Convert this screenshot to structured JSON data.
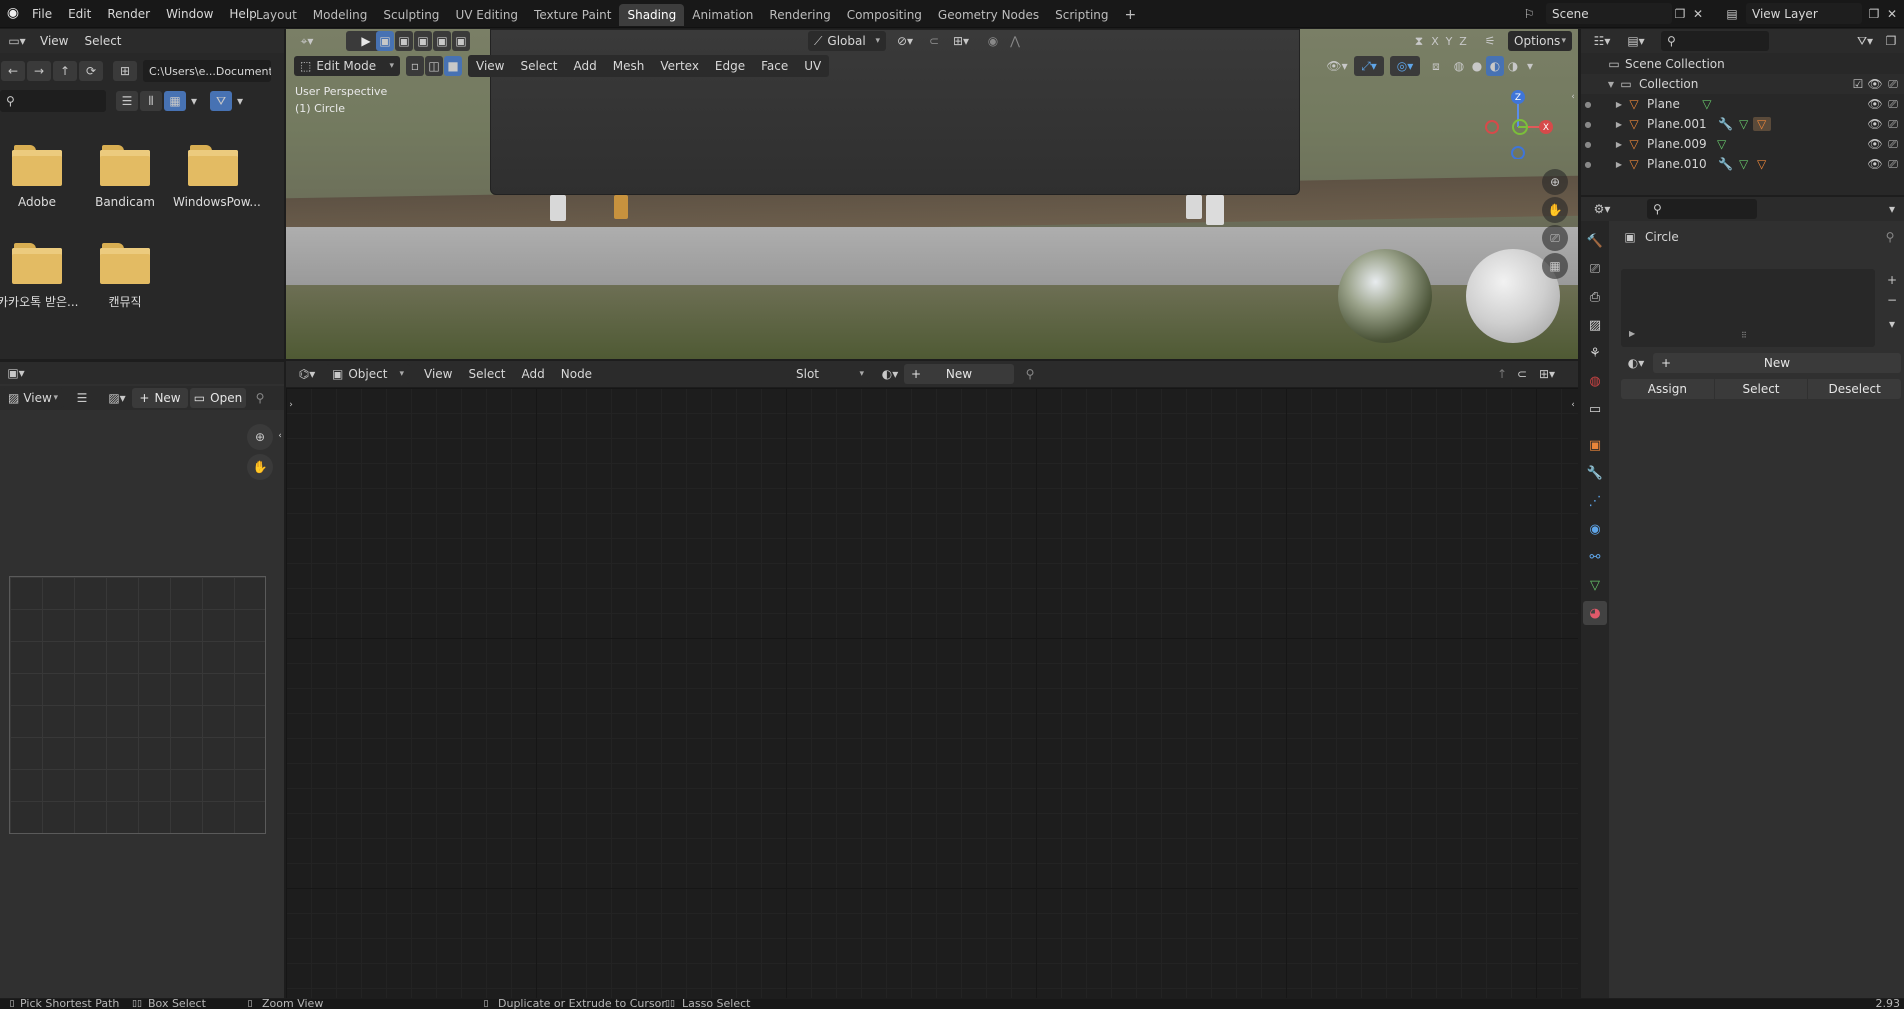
{
  "topbar": {
    "menus": [
      "File",
      "Edit",
      "Render",
      "Window",
      "Help"
    ],
    "workspaces": [
      "Layout",
      "Modeling",
      "Sculpting",
      "UV Editing",
      "Texture Paint",
      "Shading",
      "Animation",
      "Rendering",
      "Compositing",
      "Geometry Nodes",
      "Scripting"
    ],
    "active_workspace": "Shading",
    "scene": "Scene",
    "view_layer": "View Layer"
  },
  "file_browser": {
    "menus": [
      "View",
      "Select"
    ],
    "path": "C:\\Users\\e...Documents\\",
    "folders": [
      "Adobe",
      "Bandicam",
      "WindowsPow...",
      "카카오톡 받은...",
      "캔뮤직"
    ]
  },
  "image_editor": {
    "view_label": "View",
    "new_label": "New",
    "open_label": "Open"
  },
  "viewport": {
    "mode": "Edit Mode",
    "menus": [
      "View",
      "Select",
      "Add",
      "Mesh",
      "Vertex",
      "Edge",
      "Face",
      "UV"
    ],
    "transform_orientation": "Global",
    "options_label": "Options",
    "overlay_title": "User Perspective",
    "overlay_object": "(1) Circle",
    "axes": {
      "x": "X",
      "y": "Y",
      "z": "Z"
    }
  },
  "node_editor": {
    "object_label": "Object",
    "menus": [
      "View",
      "Select",
      "Add",
      "Node"
    ],
    "slot_label": "Slot",
    "new_label": "New"
  },
  "outliner": {
    "root": "Scene Collection",
    "collection": "Collection",
    "items": [
      "Plane",
      "Plane.001",
      "Plane.009",
      "Plane.010"
    ]
  },
  "properties": {
    "object_name": "Circle",
    "new_label": "New",
    "assign_label": "Assign",
    "select_label": "Select",
    "deselect_label": "Deselect"
  },
  "statusbar": {
    "items": [
      "Pick Shortest Path",
      "Box Select",
      "Zoom View",
      "Duplicate or Extrude to Cursor",
      "Lasso Select"
    ],
    "version": "2.93"
  },
  "colors": {
    "accent": "#4772b3",
    "header_bg": "#2b2b2b",
    "topbar_bg": "#181818",
    "folder": "#e3bb63"
  }
}
